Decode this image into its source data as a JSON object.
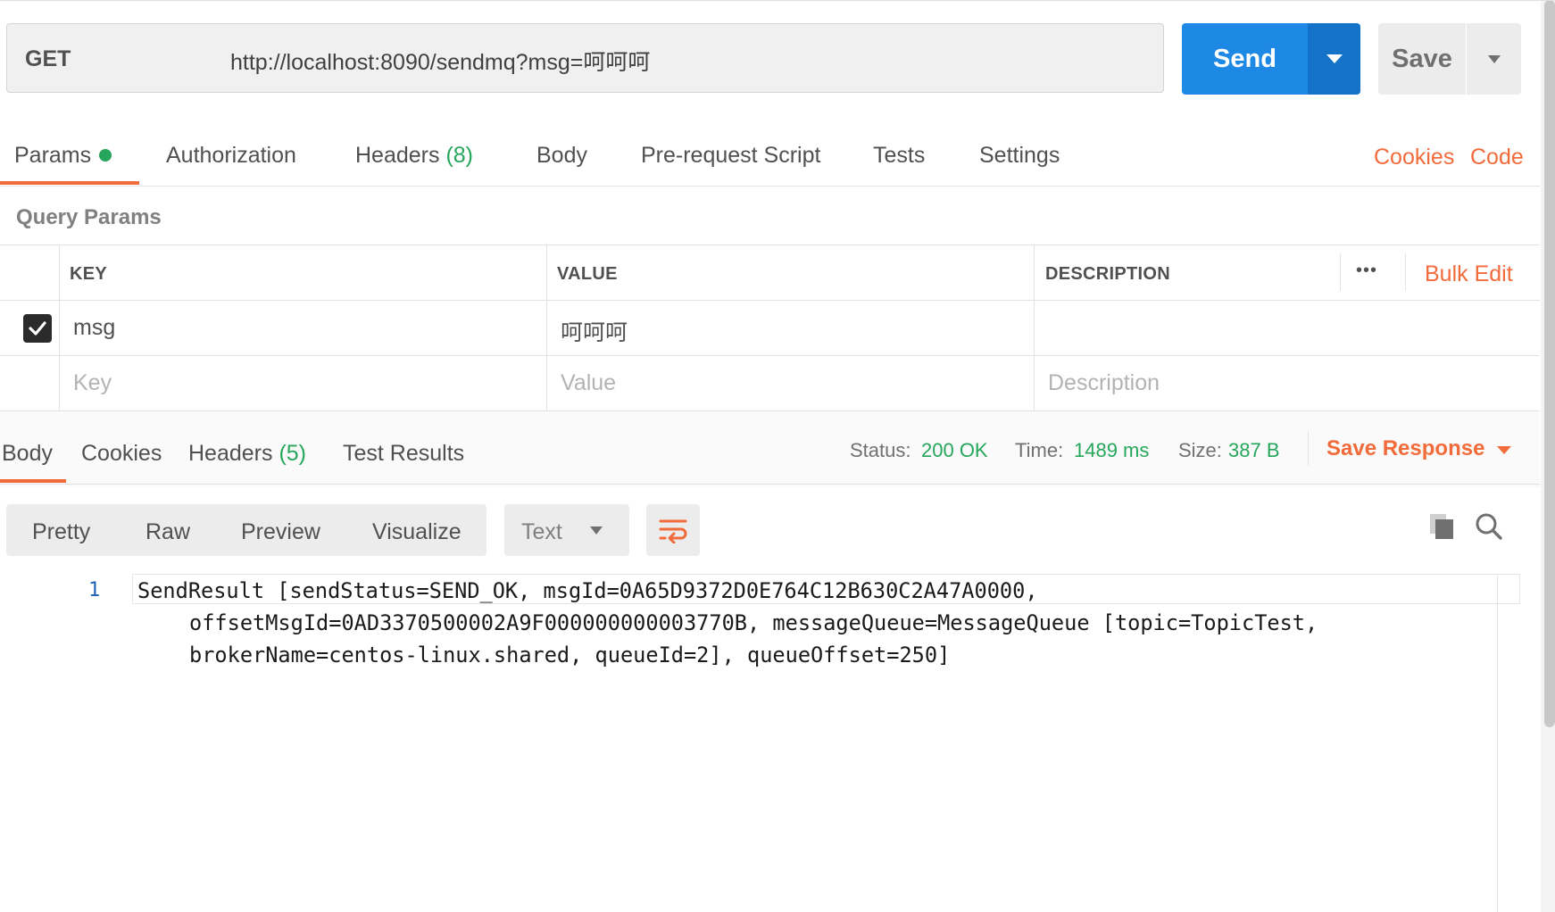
{
  "request": {
    "method": "GET",
    "url": "http://localhost:8090/sendmq?msg=呵呵呵",
    "send_label": "Send",
    "save_label": "Save"
  },
  "request_tabs": {
    "params": "Params",
    "authorization": "Authorization",
    "headers": "Headers",
    "headers_count": "(8)",
    "body": "Body",
    "pre_request": "Pre-request Script",
    "tests": "Tests",
    "settings": "Settings",
    "cookies": "Cookies",
    "code": "Code"
  },
  "query_params": {
    "title": "Query Params",
    "columns": {
      "key": "KEY",
      "value": "VALUE",
      "description": "DESCRIPTION"
    },
    "more": "•••",
    "bulk_edit": "Bulk Edit",
    "rows": [
      {
        "checked": true,
        "key": "msg",
        "value": "呵呵呵",
        "description": ""
      }
    ],
    "placeholders": {
      "key": "Key",
      "value": "Value",
      "description": "Description"
    }
  },
  "response_tabs": {
    "body": "Body",
    "cookies": "Cookies",
    "headers": "Headers",
    "headers_count": "(5)",
    "test_results": "Test Results"
  },
  "response_meta": {
    "status_label": "Status:",
    "status_value": "200 OK",
    "time_label": "Time:",
    "time_value": "1489 ms",
    "size_label": "Size:",
    "size_value": "387 B",
    "save_response": "Save Response"
  },
  "body_toolbar": {
    "pretty": "Pretty",
    "raw": "Raw",
    "preview": "Preview",
    "visualize": "Visualize",
    "format": "Text"
  },
  "response_body": {
    "line_number": "1",
    "lines": [
      "SendResult [sendStatus=SEND_OK, msgId=0A65D9372D0E764C12B630C2A47A0000,",
      "offsetMsgId=0AD3370500002A9F000000000003770B, messageQueue=MessageQueue [topic=TopicTest,",
      "brokerName=centos-linux.shared, queueId=2], queueOffset=250]"
    ]
  },
  "colors": {
    "accent": "#f26b3a",
    "send_blue": "#1e88e5",
    "success_green": "#26a65b"
  }
}
